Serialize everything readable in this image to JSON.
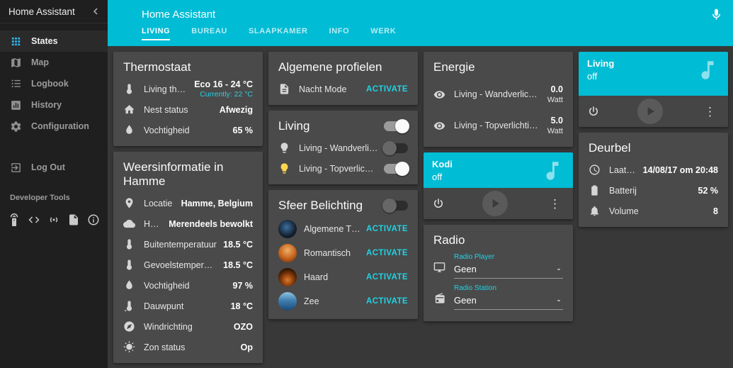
{
  "accent": "#00bcd4",
  "sidebar": {
    "app_title": "Home Assistant",
    "items": [
      {
        "label": "States"
      },
      {
        "label": "Map"
      },
      {
        "label": "Logbook"
      },
      {
        "label": "History"
      },
      {
        "label": "Configuration"
      },
      {
        "label": "Log Out"
      }
    ],
    "dev_tools_label": "Developer Tools"
  },
  "header": {
    "title": "Home Assistant",
    "tabs": [
      "LIVING",
      "BUREAU",
      "SLAAPKAMER",
      "INFO",
      "WERK"
    ]
  },
  "thermostaat": {
    "title": "Thermostaat",
    "rows": [
      {
        "label": "Living thermostaat",
        "value": "Eco 16 - 24 °C",
        "sub": "Currently: 22 °C"
      },
      {
        "label": "Nest status",
        "value": "Afwezig"
      },
      {
        "label": "Vochtigheid",
        "value": "65 %"
      }
    ]
  },
  "weer": {
    "title": "Weersinformatie in Hamme",
    "rows": [
      {
        "label": "Locatie",
        "value": "Hamme, Belgium"
      },
      {
        "label": "Huidige toestand",
        "value": "Merendeels bewolkt"
      },
      {
        "label": "Buitentemperatuur",
        "value": "18.5 °C"
      },
      {
        "label": "Gevoelstemperatuur",
        "value": "18.5 °C"
      },
      {
        "label": "Vochtigheid",
        "value": "97 %"
      },
      {
        "label": "Dauwpunt",
        "value": "18 °C"
      },
      {
        "label": "Windrichting",
        "value": "OZO"
      },
      {
        "label": "Zon status",
        "value": "Op"
      }
    ]
  },
  "profielen": {
    "title": "Algemene profielen",
    "rows": [
      {
        "label": "Nacht Mode",
        "action": "ACTIVATE"
      }
    ]
  },
  "living_lights": {
    "title": "Living",
    "rows": [
      {
        "label": "Living - Wandverlichting"
      },
      {
        "label": "Living - Topverlichting"
      }
    ]
  },
  "sfeer": {
    "title": "Sfeer Belichting",
    "rows": [
      {
        "label": "Algemene TV Modus",
        "action": "ACTIVATE"
      },
      {
        "label": "Romantisch",
        "action": "ACTIVATE"
      },
      {
        "label": "Haard",
        "action": "ACTIVATE"
      },
      {
        "label": "Zee",
        "action": "ACTIVATE"
      }
    ]
  },
  "energie": {
    "title": "Energie",
    "rows": [
      {
        "label": "Living - Wandverlichting (Verb...",
        "value": "0.0",
        "unit": "Watt"
      },
      {
        "label": "Living - Topverlichting (Verb...",
        "value": "5.0",
        "unit": "Watt"
      }
    ]
  },
  "kodi": {
    "title": "Kodi",
    "state": "off"
  },
  "radio": {
    "title": "Radio",
    "selects": [
      {
        "label": "Radio Player",
        "value": "Geen"
      },
      {
        "label": "Radio Station",
        "value": "Geen"
      }
    ]
  },
  "living_media": {
    "title": "Living",
    "state": "off"
  },
  "deurbel": {
    "title": "Deurbel",
    "rows": [
      {
        "label": "Laatste activiteit",
        "value": "14/08/17 om 20:48"
      },
      {
        "label": "Batterij",
        "value": "52 %"
      },
      {
        "label": "Volume",
        "value": "8"
      }
    ]
  }
}
